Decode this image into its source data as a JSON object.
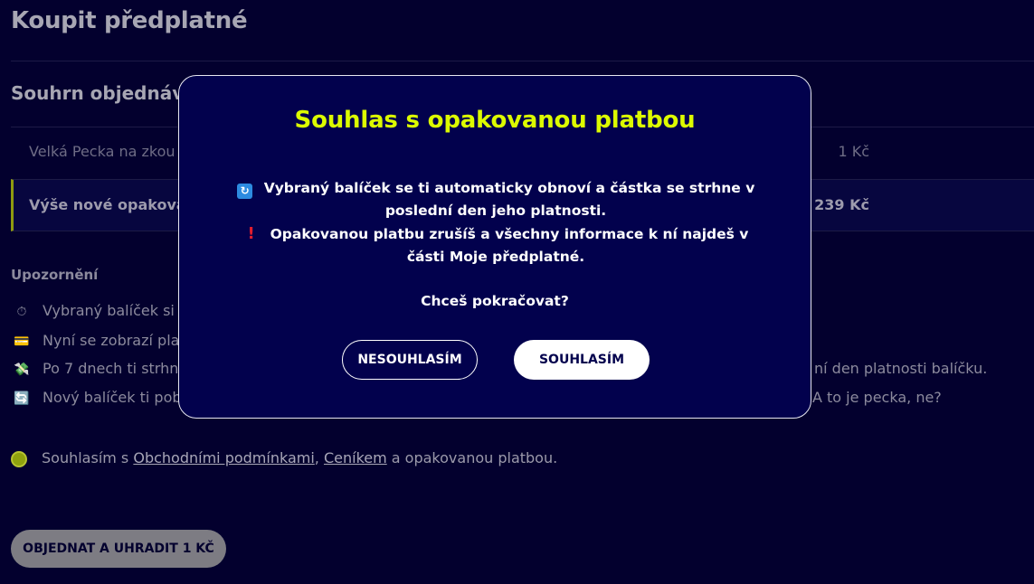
{
  "page": {
    "title": "Koupit předplatné"
  },
  "summary": {
    "title": "Souhrn objednáv",
    "rows": [
      {
        "label": "Velká Pecka na zkou",
        "price": "1 Kč"
      },
      {
        "label": "Výše nové opakovar",
        "price": "239 Kč"
      }
    ]
  },
  "notices": {
    "title": "Upozornění",
    "items": [
      {
        "icon": "stopwatch-icon",
        "glyph": "⏱",
        "text": "Vybraný balíček si",
        "tail": ""
      },
      {
        "icon": "credit-card-icon",
        "glyph": "💳",
        "text": "Nyní se zobrazí pla",
        "tail": ""
      },
      {
        "icon": "money-wings-icon",
        "glyph": "💸",
        "text": "Po 7 dnech ti strhn",
        "tail": "ní den platnosti balíčku."
      },
      {
        "icon": "refresh-icon",
        "glyph": "🔄",
        "text": "Nový balíček ti pob",
        "tail": "A to je pecka, ne?"
      }
    ]
  },
  "agreement": {
    "prefix": "Souhlasím s ",
    "link_terms": "Obchodními podmínkami",
    "separator": ", ",
    "link_pricing": "Ceníkem",
    "suffix": " a opakovanou platbou."
  },
  "order_button": {
    "label": "OBJEDNAT A UHRADIT 1 KČ"
  },
  "modal": {
    "title": "Souhlas s opakovanou platbou",
    "line1": "Vybraný balíček se ti automaticky obnoví a částka se strhne v poslední den jeho platnosti.",
    "line2_prefix": "Opakovanou platbu zrušíš a všechny informace k ní najdeš v části ",
    "line2_strong": "Moje předplatné",
    "line2_suffix": ".",
    "question": "Chceš pokračovat?",
    "decline_label": "NESOUHLASÍM",
    "accept_label": "SOUHLASÍM"
  },
  "colors": {
    "background": "#03002e",
    "modal_background": "#02014d",
    "accent": "#dcfb00",
    "check": "#8fa20e"
  }
}
